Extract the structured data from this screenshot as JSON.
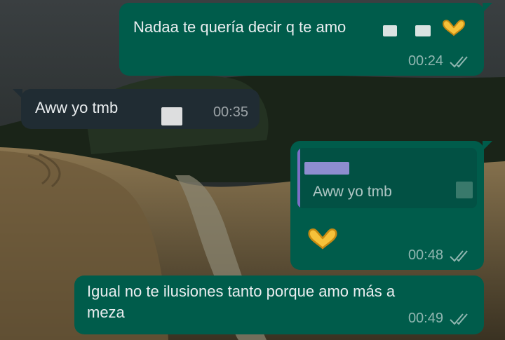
{
  "chat": {
    "messages": [
      {
        "direction": "outgoing",
        "text": "Nadaa te quería decir q te amo",
        "time": "00:24",
        "status_icon": "double-check-icon",
        "emoji": "yellow-heart-hands"
      },
      {
        "direction": "incoming",
        "text": "Aww yo tmb",
        "time": "00:35"
      },
      {
        "direction": "outgoing",
        "quoted_text": "Aww yo tmb",
        "emoji": "yellow-heart-hands",
        "time": "00:48",
        "status_icon": "double-check-icon"
      },
      {
        "direction": "outgoing",
        "text": "Igual no te ilusiones tanto porque amo más a\nmeza",
        "time": "00:49",
        "status_icon": "double-check-icon"
      }
    ]
  },
  "colors": {
    "outgoing_bubble": "#005c4b",
    "incoming_bubble": "#202c33",
    "quote_bar": "#7b6fc6",
    "text": "#e9edef"
  }
}
